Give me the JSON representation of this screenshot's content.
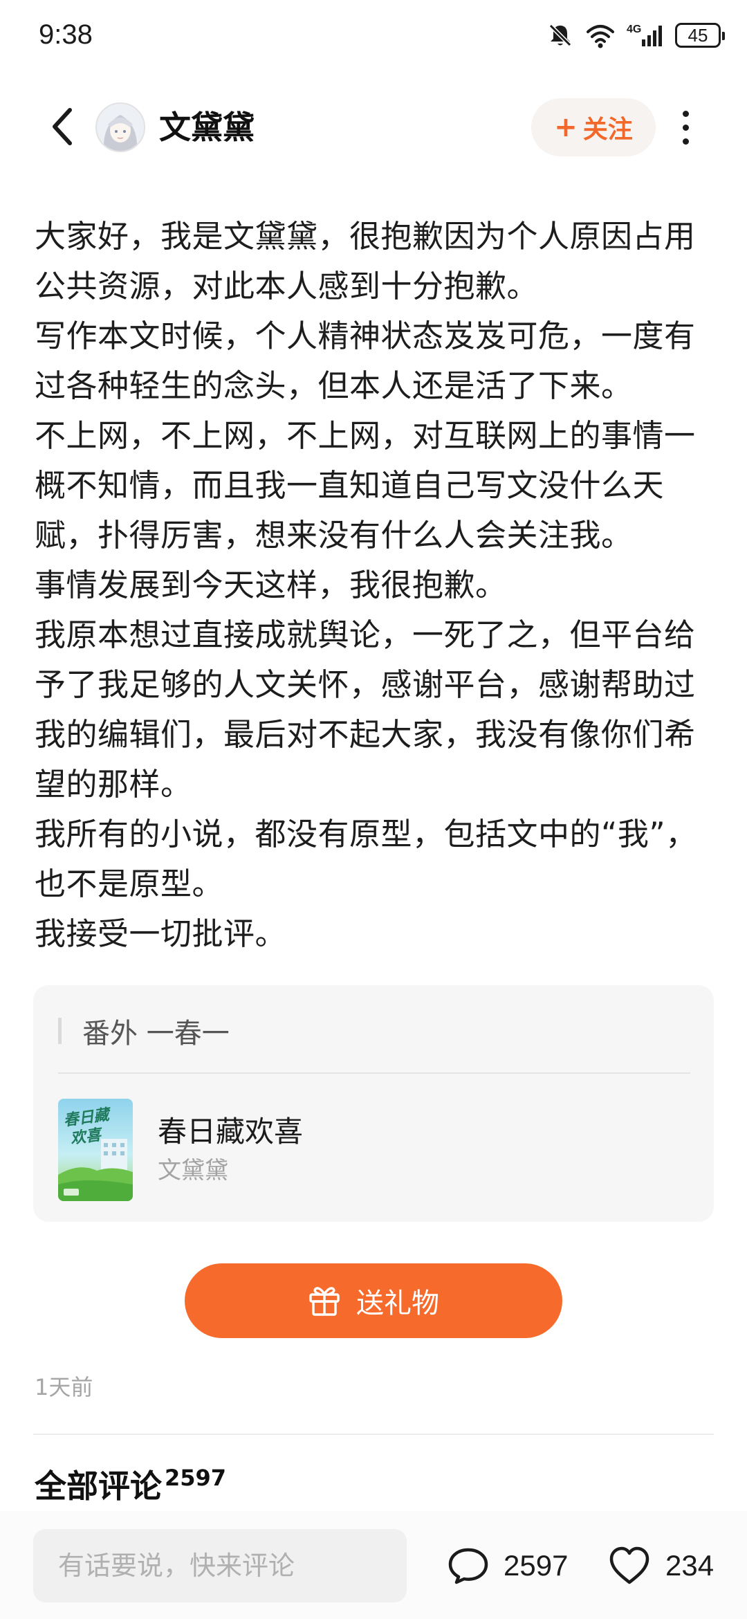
{
  "status_bar": {
    "time": "9:38",
    "network": "4G",
    "battery": "45",
    "icons": [
      "bell-muted-icon",
      "wifi-icon",
      "signal-icon",
      "battery-icon"
    ]
  },
  "header": {
    "author_name": "文黛黛",
    "follow_plus": "+",
    "follow_label": "关注",
    "icons": [
      "back-arrow-icon",
      "more-vertical-icon"
    ]
  },
  "article": {
    "paragraphs": [
      "大家好，我是文黛黛，很抱歉因为个人原因占用公共资源，对此本人感到十分抱歉。",
      "写作本文时候，个人精神状态岌岌可危，一度有过各种轻生的念头，但本人还是活了下来。",
      "不上网，不上网，不上网，对互联网上的事情一概不知情，而且我一直知道自己写文没什么天赋，扑得厉害，想来没有什么人会关注我。",
      "事情发展到今天这样，我很抱歉。",
      "我原本想过直接成就舆论，一死了之，但平台给予了我足够的人文关怀，感谢平台，感谢帮助过我的编辑们，最后对不起大家，我没有像你们希望的那样。",
      "我所有的小说，都没有原型，包括文中的“我”，也不是原型。",
      "我接受一切批评。"
    ]
  },
  "book_card": {
    "chapter_title": "番外 一春一",
    "book_title": "春日藏欢喜",
    "book_author": "文黛黛",
    "cover_title_art": "春日藏欢喜"
  },
  "gift_button": {
    "label": "送礼物",
    "icon": "gift-icon"
  },
  "post_meta": {
    "time_ago": "1天前"
  },
  "comments": {
    "title": "全部评论",
    "count": "2597"
  },
  "bottom_bar": {
    "input_placeholder": "有话要说，快来评论",
    "comment_count": "2597",
    "like_count": "234",
    "icons": [
      "comment-bubble-icon",
      "heart-icon"
    ]
  },
  "colors": {
    "accent": "#f66a2b",
    "follow_text": "#f2682a",
    "muted_text": "#a5a5a5",
    "card_background": "#f6f6f6"
  }
}
